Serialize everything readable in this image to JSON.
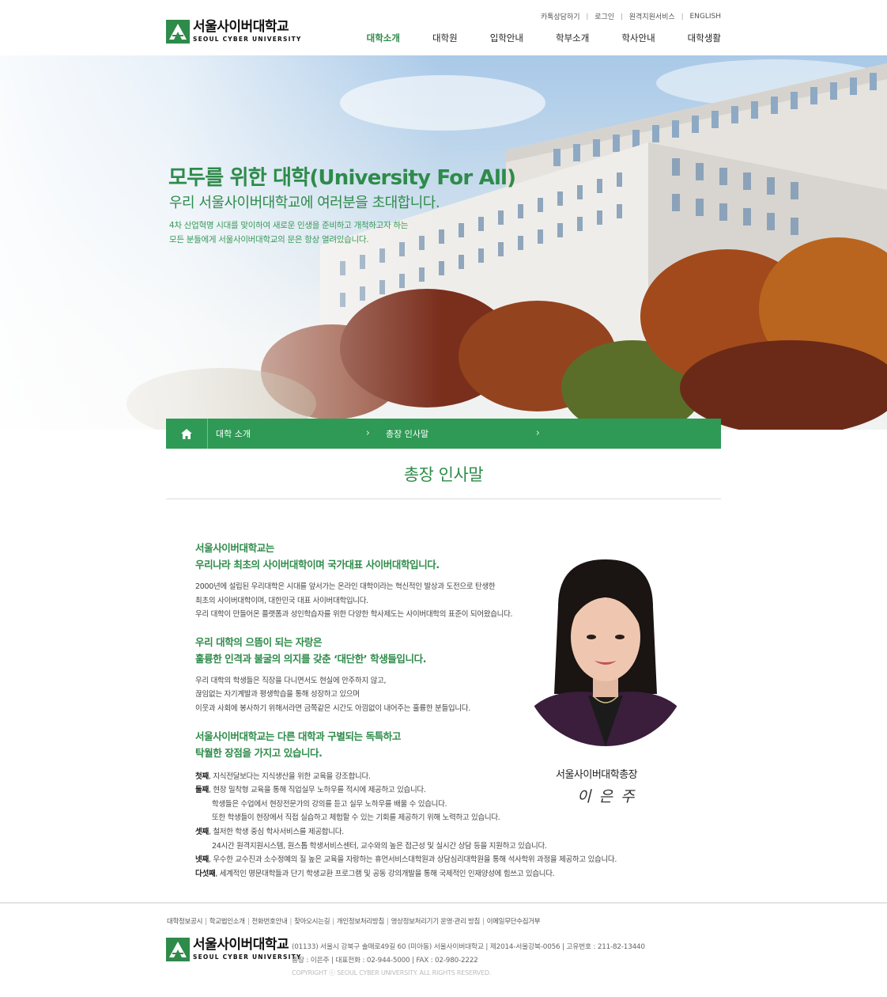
{
  "header": {
    "logo_ko": "서울사이버대학교",
    "logo_en": "SEOUL CYBER UNIVERSITY",
    "util": [
      "카톡상담하기",
      "로그인",
      "원격지원서비스",
      "ENGLISH"
    ],
    "gnb": [
      "대학소개",
      "대학원",
      "입학안내",
      "학부소개",
      "학사안내",
      "대학생활"
    ]
  },
  "hero": {
    "title": "모두를 위한 대학(University For All)",
    "subtitle": "우리 서울사이버대학교에 여러분을 초대합니다.",
    "desc1": "4차 산업혁명 시대를 맞이하여 새로운 인생을 준비하고 개척하고자 하는",
    "desc2": "모든 분들에게 서울사이버대학교의 문은 항상 열려있습니다."
  },
  "location": {
    "home_icon": "home-icon",
    "depth1": "대학 소개",
    "depth2": "총장 인사말"
  },
  "page": {
    "title": "총장 인사말"
  },
  "content": {
    "h1a": "서울사이버대학교는",
    "h1b": "우리나라 최초의 사이버대학이며 국가대표 사이버대학입니다.",
    "p1a": "2000년에 설립된 우리대학은 시대를 앞서가는 온라인 대학이라는 혁신적인 발상과 도전으로 탄생한",
    "p1b": "최초의 사이버대학이며,  대한민국 대표 사이버대학입니다.",
    "p1c": "우리 대학이 만들어온 플랫폼과 성인학습자를 위한 다양한 학사제도는 사이버대학의 표준이 되어왔습니다.",
    "h2a": "우리 대학의 으뜸이 되는 자랑은",
    "h2b": "훌륭한 인격과 불굴의 의지를 갖춘 ‘대단한’ 학생들입니다.",
    "p2a": "우리 대학의 학생들은 직장을 다니면서도 현실에 안주하지 않고,",
    "p2b": "끊임없는 자기계발과 평생학습을 통해 성장하고 있으며",
    "p2c": "이웃과 사회에 봉사하기 위해서라면 금쪽같은 시간도 아낌없이 내어주는 훌륭한 분들입니다.",
    "h3a": "서울사이버대학교는 다른 대학과 구별되는 독특하고",
    "h3b": "탁월한 장점을 가지고 있습니다.",
    "l1b": "첫째",
    "l1": ", 지식전달보다는 지식생산을 위한 교육을 강조합니다.",
    "l2b": "둘째",
    "l2": ", 현장 밀착형 교육을 통해 직업실무 노하우를 적시에 제공하고 있습니다.",
    "l2c": "학생들은 수업에서 현장전문가의 강의를 듣고 실무 노하우를 배울 수 있습니다.",
    "l2d": "또한 학생들이 현장에서 직접 실습하고 체험할 수 있는 기회를 제공하기 위해 노력하고 있습니다.",
    "l3b": "셋째",
    "l3": ", 철저한 학생 중심 학사서비스를 제공합니다.",
    "l3c": "24시간 원격지원시스템, 원스톱 학생서비스센터, 교수와의 높은 접근성 및 실시간 상담 등을 지원하고 있습니다.",
    "l4b": "넷째",
    "l4": ", 우수한 교수진과 소수정예의 질 높은 교육을 자랑하는 휴먼서비스대학원과 상담심리대학원을 통해 석사학위 과정을 제공하고 있습니다.",
    "l5b": "다섯째",
    "l5": ", 세계적인 명문대학들과 단기 학생교환 프로그램 및 공동 강의개발을 통해 국제적인 인재양성에 힘쓰고 있습니다."
  },
  "president": {
    "title": "서울사이버대학총장",
    "signature": "이은주"
  },
  "footer": {
    "links": [
      "대학정보공시",
      "학교법인소개",
      "전화번호안내",
      "찾아오시는길",
      "개인정보처리방침",
      "영상정보처리기기 운영·관리 방침",
      "이메일무단수집거부"
    ],
    "line1": "(01133) 서울시 강북구 솔매로49길 60 (미아동) 서울사이버대학교 | 제2014-서울강북-0056 | 고유번호 : 211-82-13440",
    "line2": "총장 : 이은주  |  대표전화 : 02-944-5000  |  FAX : 02-980-2222",
    "copyright": "COPYRIGHT ⓒ SEOUL CYBER UNIVERSITY. ALL RIGHTS RESERVED."
  },
  "colors": {
    "brand": "#2e8b4a",
    "bar": "#2e9a55"
  }
}
